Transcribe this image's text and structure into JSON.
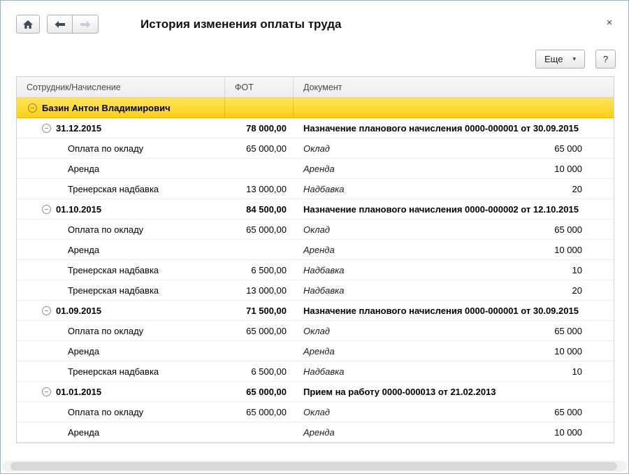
{
  "window": {
    "title": "История изменения оплаты труда",
    "close_label": "×"
  },
  "toolbar": {
    "more_label": "Еще",
    "more_chevron": "▾",
    "help_label": "?"
  },
  "table": {
    "columns": [
      "Сотрудник/Начисление",
      "ФОТ",
      "Документ"
    ],
    "employee": "Базин Антон Владимирович",
    "groups": [
      {
        "date": "31.12.2015",
        "fot": "78 000,00",
        "document": "Назначение планового начисления 0000-000001 от 30.09.2015",
        "rows": [
          {
            "name": "Оплата по окладу",
            "fot": "65 000,00",
            "doc_label": "Оклад",
            "doc_value": "65 000"
          },
          {
            "name": "Аренда",
            "fot": "",
            "doc_label": "Аренда",
            "doc_value": "10 000"
          },
          {
            "name": "Тренерская надбавка",
            "fot": "13 000,00",
            "doc_label": "Надбавка",
            "doc_value": "20"
          }
        ]
      },
      {
        "date": "01.10.2015",
        "fot": "84 500,00",
        "document": "Назначение планового начисления 0000-000002 от 12.10.2015",
        "rows": [
          {
            "name": "Оплата по окладу",
            "fot": "65 000,00",
            "doc_label": "Оклад",
            "doc_value": "65 000"
          },
          {
            "name": "Аренда",
            "fot": "",
            "doc_label": "Аренда",
            "doc_value": "10 000"
          },
          {
            "name": "Тренерская надбавка",
            "fot": "6 500,00",
            "doc_label": "Надбавка",
            "doc_value": "10"
          },
          {
            "name": "Тренерская надбавка",
            "fot": "13 000,00",
            "doc_label": "Надбавка",
            "doc_value": "20"
          }
        ]
      },
      {
        "date": "01.09.2015",
        "fot": "71 500,00",
        "document": "Назначение планового начисления 0000-000001 от 30.09.2015",
        "rows": [
          {
            "name": "Оплата по окладу",
            "fot": "65 000,00",
            "doc_label": "Оклад",
            "doc_value": "65 000"
          },
          {
            "name": "Аренда",
            "fot": "",
            "doc_label": "Аренда",
            "doc_value": "10 000"
          },
          {
            "name": "Тренерская надбавка",
            "fot": "6 500,00",
            "doc_label": "Надбавка",
            "doc_value": "10"
          }
        ]
      },
      {
        "date": "01.01.2015",
        "fot": "65 000,00",
        "document": "Прием на работу 0000-000013 от 21.02.2013",
        "rows": [
          {
            "name": "Оплата по окладу",
            "fot": "65 000,00",
            "doc_label": "Оклад",
            "doc_value": "65 000"
          },
          {
            "name": "Аренда",
            "fot": "",
            "doc_label": "Аренда",
            "doc_value": "10 000"
          }
        ]
      }
    ]
  }
}
